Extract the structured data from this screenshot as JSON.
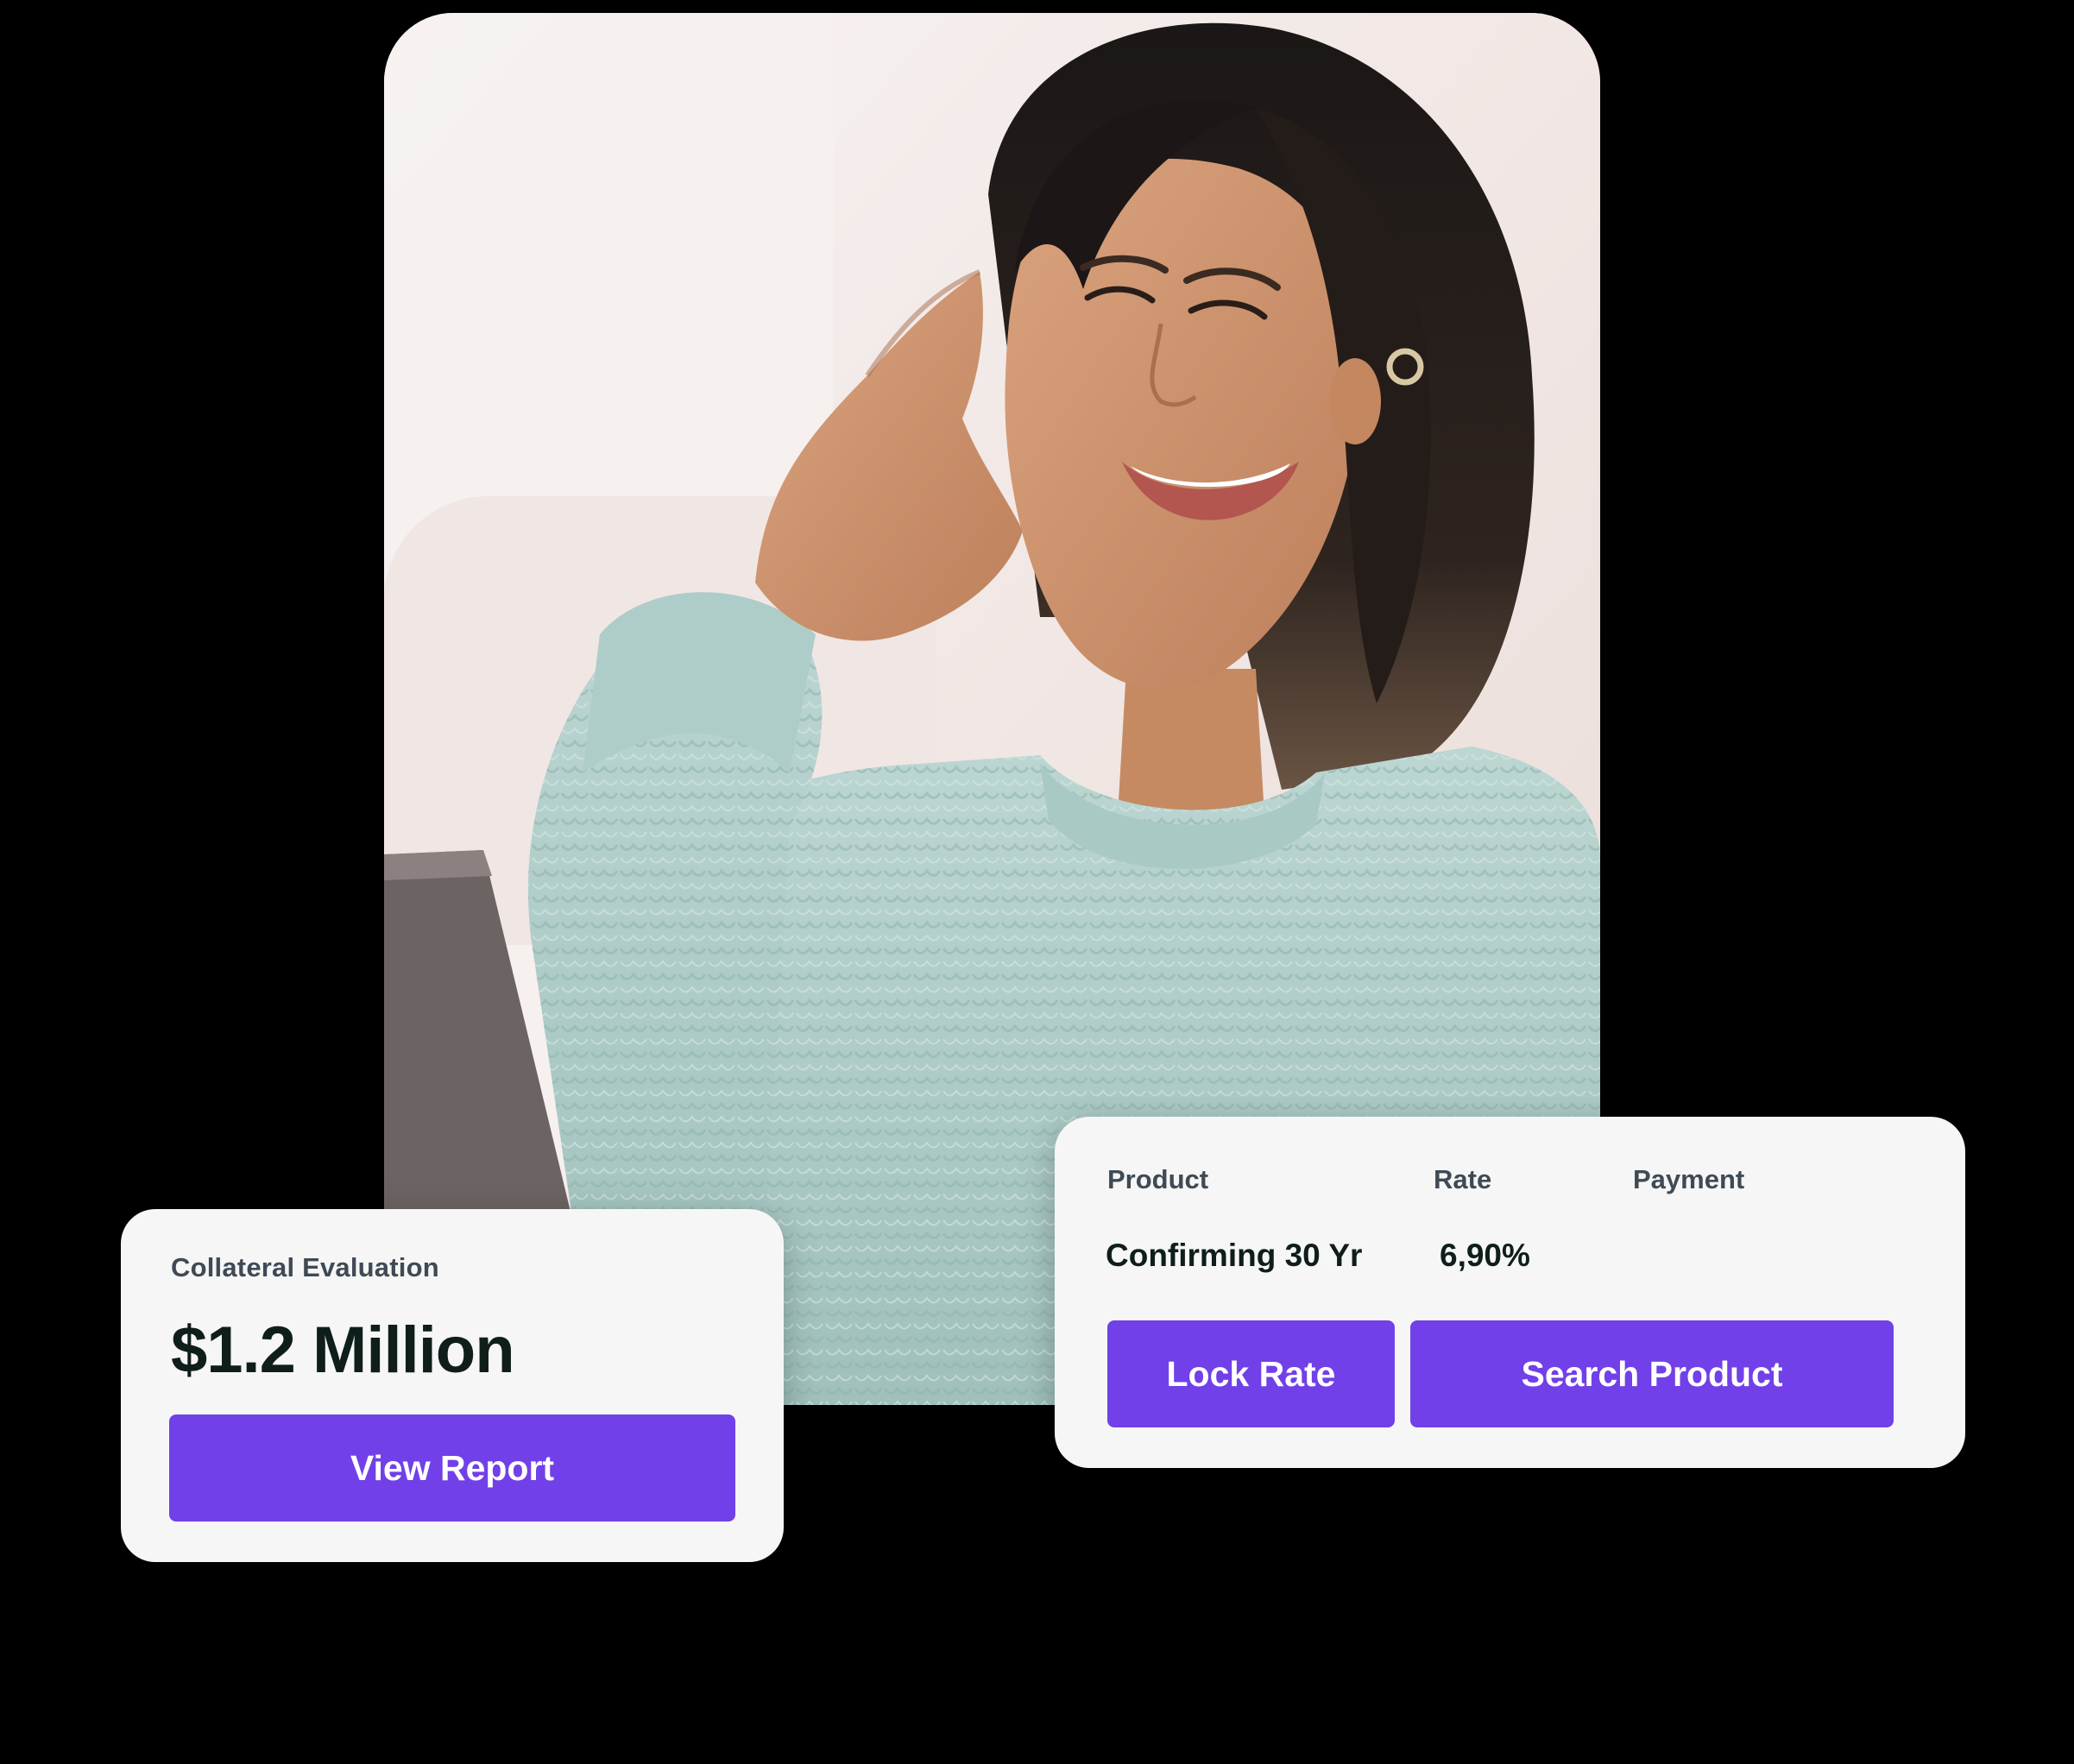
{
  "photo": {
    "alt": "Smiling woman in a mint knit sweater looking at a laptop"
  },
  "collateral_card": {
    "label": "Collateral Evaluation",
    "value": "$1.2 Million",
    "button_label": "View Report"
  },
  "product_card": {
    "columns": [
      "Product",
      "Rate",
      "Payment"
    ],
    "row": {
      "product": "Confirming 30 Yr",
      "rate": "6,90%",
      "payment": ""
    },
    "lock_button_label": "Lock Rate",
    "search_button_label": "Search Product"
  },
  "colors": {
    "accent": "#7140e8",
    "card_bg": "#f6f6f7",
    "page_bg": "#000000",
    "heading_text": "#0f1e1b",
    "label_text": "#3f4a55"
  }
}
